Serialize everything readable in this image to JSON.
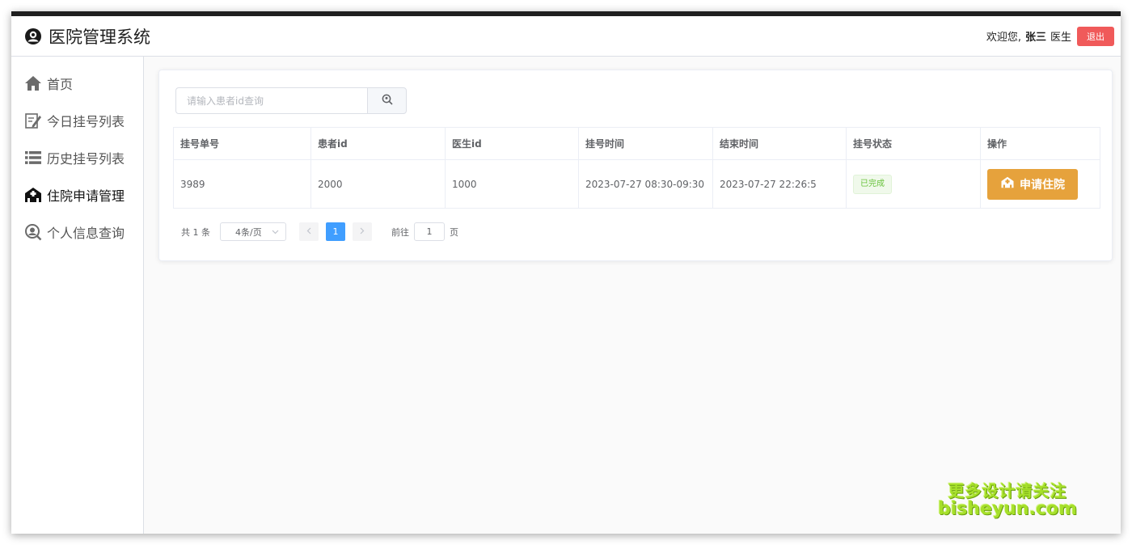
{
  "app": {
    "title": "医院管理系统"
  },
  "user": {
    "welcome": "欢迎您,",
    "name": "张三",
    "role": "医生",
    "logout_label": "退出"
  },
  "sidebar": {
    "items": [
      {
        "label": "首页",
        "icon": "home-icon"
      },
      {
        "label": "今日挂号列表",
        "icon": "edit-icon"
      },
      {
        "label": "历史挂号列表",
        "icon": "list-icon"
      },
      {
        "label": "住院申请管理",
        "icon": "hospital-icon",
        "active": true
      },
      {
        "label": "个人信息查询",
        "icon": "user-search-icon"
      }
    ]
  },
  "search": {
    "placeholder": "请输入患者id查询",
    "value": ""
  },
  "table": {
    "columns": [
      "挂号单号",
      "患者id",
      "医生id",
      "挂号时间",
      "结束时间",
      "挂号状态",
      "操作"
    ],
    "rows": [
      {
        "reg_no": "3989",
        "patient_id": "2000",
        "doctor_id": "1000",
        "reg_time": "2023-07-27 08:30-09:30",
        "end_time": "2023-07-27 22:26:5",
        "status": "已完成",
        "action_label": "申请住院"
      }
    ]
  },
  "pagination": {
    "total_text": "共 1 条",
    "page_size": "4条/页",
    "current_page": "1",
    "goto_prefix": "前往",
    "goto_value": "1",
    "goto_suffix": "页"
  },
  "watermark": {
    "line1": "更多设计请关注",
    "line2": "bisheyun.com"
  },
  "colors": {
    "logout": "#f05a5a",
    "action": "#e6a23c",
    "status": "#67c23a",
    "page_active": "#409eff"
  }
}
